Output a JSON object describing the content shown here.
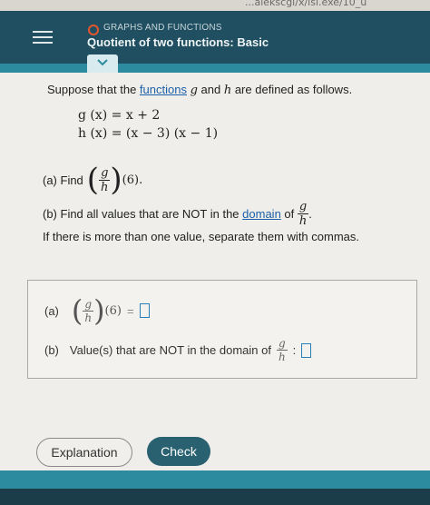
{
  "browser": {
    "url_fragment": "...alekscgi/x/isl.exe/10_u"
  },
  "header": {
    "topic": "GRAPHS AND FUNCTIONS",
    "title": "Quotient of two functions: Basic"
  },
  "problem": {
    "intro_before": "Suppose that the ",
    "intro_link": "functions",
    "intro_g": "g",
    "intro_and": " and ",
    "intro_h": "h",
    "intro_after": " are defined as follows.",
    "eq_g": "g (x) = x + 2",
    "eq_h": "h (x) = (x − 3) (x − 1)",
    "part_a_label": "(a) Find",
    "frac_num": "g",
    "frac_den": "h",
    "part_a_arg": "(6).",
    "part_b_text": "(b) Find all values that are NOT in the",
    "part_b_link": "domain",
    "part_b_of": "of",
    "part_b_period": ".",
    "part_b_note": "If there is more than one value, separate them with commas."
  },
  "answer": {
    "a_label": "(a)",
    "a_arg": "(6)",
    "a_equals": "=",
    "a_value": "",
    "b_label": "(b)",
    "b_text": "Value(s) that are NOT in the domain of",
    "b_colon": ":",
    "b_value": ""
  },
  "buttons": {
    "explanation": "Explanation",
    "check": "Check"
  },
  "colors": {
    "header": "#1f4f61",
    "accent": "#2d8ba0",
    "check_button": "#2a6170",
    "link": "#1b5fa8"
  }
}
